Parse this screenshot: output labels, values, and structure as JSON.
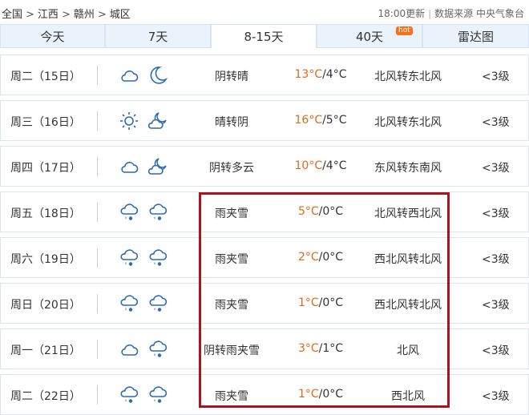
{
  "breadcrumb": [
    "全国",
    "江西",
    "赣州",
    "城区"
  ],
  "meta": {
    "update": "18:00更新",
    "source": "数据来源 中央气象台"
  },
  "tabs": [
    {
      "label": "今天",
      "active": false
    },
    {
      "label": "7天",
      "active": false
    },
    {
      "label": "8-15天",
      "active": true
    },
    {
      "label": "40天",
      "active": false,
      "badge": "hot"
    },
    {
      "label": "雷达图",
      "active": false
    }
  ],
  "rows": [
    {
      "day": "周二（15日）",
      "icons": [
        "cloud-icon",
        "moon-icon"
      ],
      "weather": "阴转晴",
      "temp_high": "13°C",
      "temp_low": "/4°C",
      "wind": "北风转东北风",
      "level": "<3级"
    },
    {
      "day": "周三（16日）",
      "icons": [
        "sun-icon",
        "cloudy-night-icon"
      ],
      "weather": "晴转阴",
      "temp_high": "16°C",
      "temp_low": "/5°C",
      "wind": "北风转东北风",
      "level": "<3级"
    },
    {
      "day": "周四（17日）",
      "icons": [
        "cloud-icon",
        "cloudy-night-icon"
      ],
      "weather": "阴转多云",
      "temp_high": "10°C",
      "temp_low": "/4°C",
      "wind": "东风转东南风",
      "level": "<3级"
    },
    {
      "day": "周五（18日）",
      "icons": [
        "sleet-icon",
        "sleet-icon"
      ],
      "weather": "雨夹雪",
      "temp_high": "5°C",
      "temp_low": "/0°C",
      "wind": "北风转西北风",
      "level": "<3级"
    },
    {
      "day": "周六（19日）",
      "icons": [
        "sleet-icon",
        "sleet-icon"
      ],
      "weather": "雨夹雪",
      "temp_high": "2°C",
      "temp_low": "/0°C",
      "wind": "西北风转北风",
      "level": "<3级"
    },
    {
      "day": "周日（20日）",
      "icons": [
        "sleet-icon",
        "sleet-icon"
      ],
      "weather": "雨夹雪",
      "temp_high": "1°C",
      "temp_low": "/0°C",
      "wind": "西北风转北风",
      "level": "<3级"
    },
    {
      "day": "周一（21日）",
      "icons": [
        "cloud-icon",
        "sleet-icon"
      ],
      "weather": "阴转雨夹雪",
      "temp_high": "3°C",
      "temp_low": "/1°C",
      "wind": "北风",
      "level": "<3级"
    },
    {
      "day": "周二（22日）",
      "icons": [
        "sleet-icon",
        "sleet-icon"
      ],
      "weather": "雨夹雪",
      "temp_high": "1°C",
      "temp_low": "/0°C",
      "wind": "西北风",
      "level": "<3级"
    }
  ],
  "colors": {
    "temp_high": "#e06a1d",
    "highlight_box": "#a8151e",
    "tab_bg": "#eaf2fb",
    "icon_stroke": "#2b6cb0"
  }
}
